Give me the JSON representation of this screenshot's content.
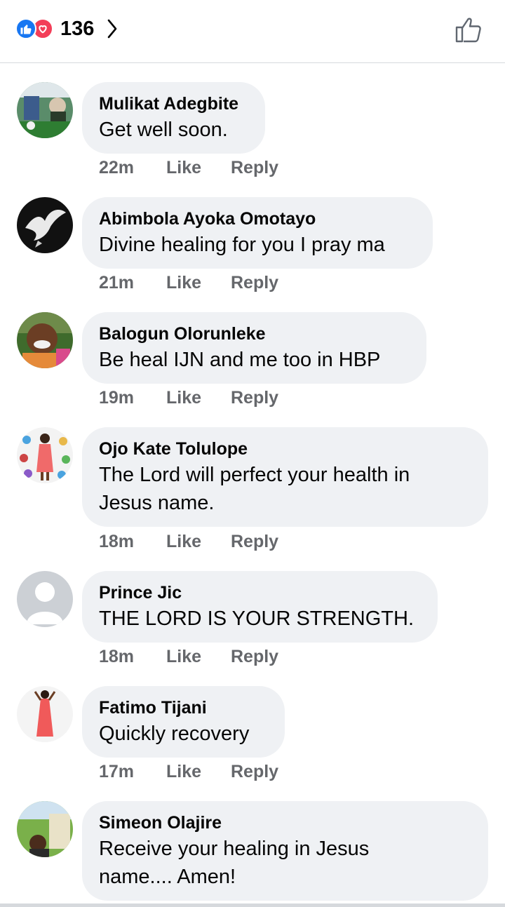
{
  "header": {
    "reaction_count": "136",
    "reaction_icons": [
      "like-reaction-icon",
      "love-reaction-icon"
    ],
    "accent_like": "#1877f2",
    "accent_love": "#f33e58"
  },
  "comments": [
    {
      "name": "Mulikat Adegbite",
      "text_lines": [
        "Get well soon."
      ],
      "time": "22m",
      "like": "Like",
      "reply": "Reply"
    },
    {
      "name": "Abimbola Ayoka Omotayo",
      "text_lines": [
        "Divine healing for you I pray ma"
      ],
      "time": "21m",
      "like": "Like",
      "reply": "Reply"
    },
    {
      "name": "Balogun Olorunleke",
      "text_lines": [
        "Be heal IJN and me too in HBP"
      ],
      "time": "19m",
      "like": "Like",
      "reply": "Reply"
    },
    {
      "name": "Ojo Kate Tolulope",
      "text_lines": [
        "The Lord will perfect your health in",
        "Jesus name."
      ],
      "time": "18m",
      "like": "Like",
      "reply": "Reply"
    },
    {
      "name": "Prince Jic",
      "text_lines": [
        "THE LORD IS YOUR STRENGTH."
      ],
      "time": "18m",
      "like": "Like",
      "reply": "Reply"
    },
    {
      "name": "Fatimo Tijani",
      "text_lines": [
        "Quickly recovery"
      ],
      "time": "17m",
      "like": "Like",
      "reply": "Reply"
    },
    {
      "name": "Simeon Olajire",
      "text_lines": [
        "Receive your healing in Jesus",
        "name.... Amen!"
      ],
      "time": "",
      "like": "",
      "reply": ""
    }
  ]
}
